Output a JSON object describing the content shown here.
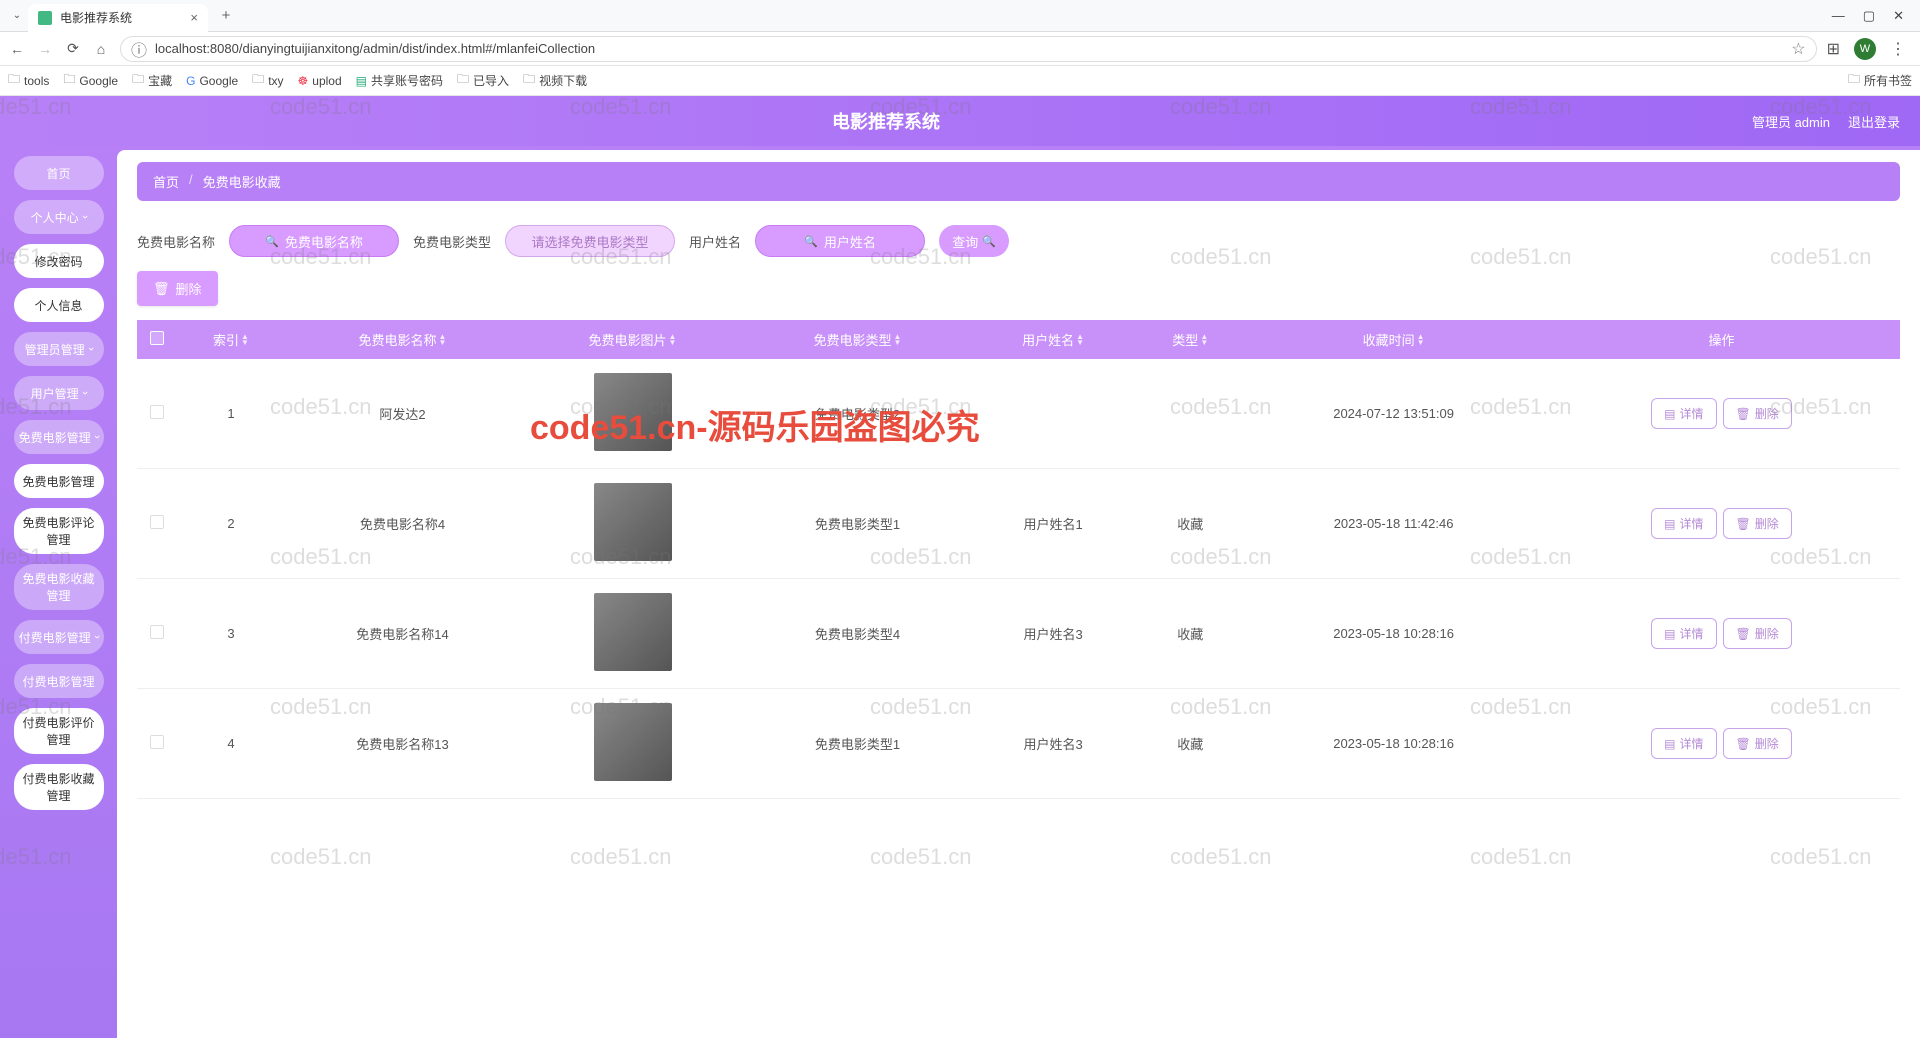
{
  "browser": {
    "tab_title": "电影推荐系统",
    "url": "localhost:8080/dianyingtuijianxitong/admin/dist/index.html#/mlanfeiCollection",
    "avatar_letter": "W",
    "bookmarks": [
      "tools",
      "Google",
      "宝藏",
      "Google",
      "txy",
      "uplod",
      "共享账号密码",
      "已导入",
      "视频下载"
    ],
    "all_bookmarks": "所有书签",
    "win": {
      "min": "—",
      "max": "▢",
      "close": "✕"
    }
  },
  "header": {
    "title": "电影推荐系统",
    "user": "管理员 admin",
    "logout": "退出登录"
  },
  "sidebar": {
    "items": [
      {
        "label": "首页",
        "cls": "lgt"
      },
      {
        "label": "个人中心",
        "cls": "lgt",
        "chev": true
      },
      {
        "label": "修改密码",
        "cls": "wht"
      },
      {
        "label": "个人信息",
        "cls": "wht"
      },
      {
        "label": "管理员管理",
        "cls": "lgt",
        "chev": true
      },
      {
        "label": "用户管理",
        "cls": "lgt",
        "chev": true
      },
      {
        "label": "免费电影管理",
        "cls": "lgt",
        "chev": true
      },
      {
        "label": "免费电影管理",
        "cls": "wht"
      },
      {
        "label": "免费电影评论管理",
        "cls": "wht"
      },
      {
        "label": "免费电影收藏管理",
        "cls": "lgt"
      },
      {
        "label": "付费电影管理",
        "cls": "lgt",
        "chev": true
      },
      {
        "label": "付费电影管理",
        "cls": "lgt"
      },
      {
        "label": "付费电影评价管理",
        "cls": "wht"
      },
      {
        "label": "付费电影收藏管理",
        "cls": "wht"
      }
    ]
  },
  "breadcrumb": {
    "home": "首页",
    "page": "免费电影收藏"
  },
  "search": {
    "lbl_name": "免费电影名称",
    "ph_name": "免费电影名称",
    "lbl_type": "免费电影类型",
    "ph_type": "请选择免费电影类型",
    "lbl_user": "用户姓名",
    "ph_user": "用户姓名",
    "btn": "查询"
  },
  "delete_btn": "删除",
  "table": {
    "cols": [
      "",
      "索引",
      "免费电影名称",
      "免费电影图片",
      "免费电影类型",
      "用户姓名",
      "类型",
      "收藏时间",
      "操作"
    ],
    "rows": [
      {
        "idx": "1",
        "name": "阿发达2",
        "type": "免费电影类型2",
        "user": "",
        "cat": "",
        "time": "2024-07-12 13:51:09"
      },
      {
        "idx": "2",
        "name": "免费电影名称4",
        "type": "免费电影类型1",
        "user": "用户姓名1",
        "cat": "收藏",
        "time": "2023-05-18 11:42:46"
      },
      {
        "idx": "3",
        "name": "免费电影名称14",
        "type": "免费电影类型4",
        "user": "用户姓名3",
        "cat": "收藏",
        "time": "2023-05-18 10:28:16"
      },
      {
        "idx": "4",
        "name": "免费电影名称13",
        "type": "免费电影类型1",
        "user": "用户姓名3",
        "cat": "收藏",
        "time": "2023-05-18 10:28:16"
      }
    ],
    "op_detail": "详情",
    "op_delete": "删除"
  },
  "watermark": {
    "repeat": "code51.cn",
    "big": "code51.cn-源码乐园盗图必究"
  }
}
